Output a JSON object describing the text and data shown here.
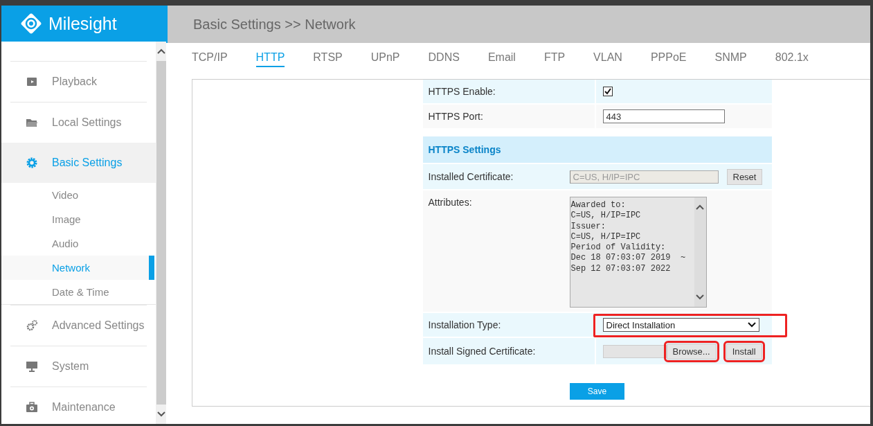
{
  "logo": {
    "text": "Milesight"
  },
  "sidebar": {
    "items": [
      {
        "label": "Playback",
        "selected": false
      },
      {
        "label": "Local Settings",
        "selected": false
      },
      {
        "label": "Basic Settings",
        "selected": true,
        "children": [
          {
            "label": "Video",
            "selected": false
          },
          {
            "label": "Image",
            "selected": false
          },
          {
            "label": "Audio",
            "selected": false
          },
          {
            "label": "Network",
            "selected": true
          },
          {
            "label": "Date & Time",
            "selected": false
          }
        ]
      },
      {
        "label": "Advanced Settings",
        "selected": false
      },
      {
        "label": "System",
        "selected": false
      },
      {
        "label": "Maintenance",
        "selected": false
      }
    ]
  },
  "breadcrumb": "Basic Settings >> Network",
  "tabs": [
    {
      "label": "TCP/IP",
      "selected": false
    },
    {
      "label": "HTTP",
      "selected": true
    },
    {
      "label": "RTSP",
      "selected": false
    },
    {
      "label": "UPnP",
      "selected": false
    },
    {
      "label": "DDNS",
      "selected": false
    },
    {
      "label": "Email",
      "selected": false
    },
    {
      "label": "FTP",
      "selected": false
    },
    {
      "label": "VLAN",
      "selected": false
    },
    {
      "label": "PPPoE",
      "selected": false
    },
    {
      "label": "SNMP",
      "selected": false
    },
    {
      "label": "802.1x",
      "selected": false
    }
  ],
  "form": [
    {
      "kind": "checkbox",
      "label": "HTTPS Enable:",
      "checked": true
    },
    {
      "kind": "text",
      "label": "HTTPS Port:",
      "value": "443"
    },
    {
      "kind": "section",
      "label": "HTTPS Settings"
    },
    {
      "kind": "readonly",
      "label": "Installed Certificate:",
      "value": "C=US, H/IP=IPC",
      "button": "Reset"
    },
    {
      "kind": "textarea",
      "label": "Attributes:",
      "value": "Awarded to:\nC=US, H/IP=IPC\nIssuer:\nC=US, H/IP=IPC\nPeriod of Validity:\nDec 18 07:03:07 2019  ~\nSep 12 07:03:07 2022"
    },
    {
      "kind": "select",
      "label": "Installation Type:",
      "value": "Direct Installation",
      "highlighted": true
    },
    {
      "kind": "file",
      "label": "Install Signed Certificate:",
      "browse": "Browse...",
      "button": "Install",
      "highlighted": true
    }
  ],
  "save": "Save"
}
